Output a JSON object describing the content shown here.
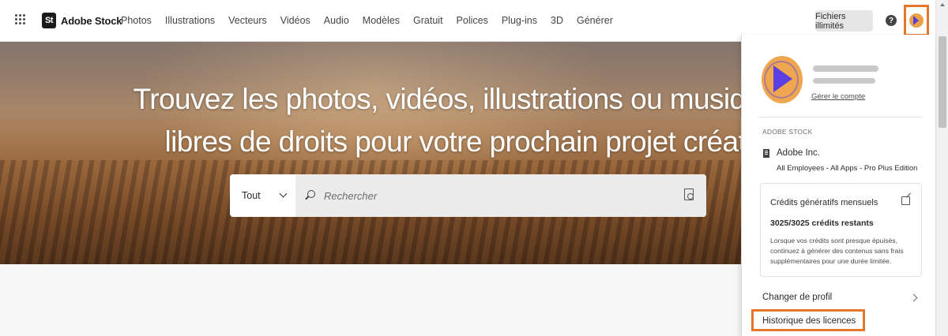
{
  "header": {
    "brand_logo": "St",
    "brand_name": "Adobe Stock",
    "nav_items": [
      "Photos",
      "Illustrations",
      "Vecteurs",
      "Vidéos",
      "Audio",
      "Modèles",
      "Gratuit",
      "Polices",
      "Plug-ins",
      "3D",
      "Générer"
    ],
    "unlimited_button": "Fichiers illimités",
    "help_icon": "?",
    "accent_color": "#e5762a"
  },
  "hero": {
    "title_line1": "Trouvez les photos, vidéos, illustrations ou musiques",
    "title_line2": "libres de droits pour votre prochain projet créatif",
    "search": {
      "type_value": "Tout",
      "placeholder": "Rechercher"
    }
  },
  "profile_panel": {
    "manage_account": "Gérer le compte",
    "section_label": "ADOBE STOCK",
    "org_name": "Adobe Inc.",
    "org_plan": "All Employees - All Apps - Pro Plus Edition",
    "credits_card": {
      "title": "Crédits génératifs mensuels",
      "credits": "3025/3025 crédits restants",
      "description": "Lorsque vos crédits sont presque épuisés, continuez à générer des contenus sans frais supplémentaires pour une durée limitée."
    },
    "menu": {
      "change_profile": "Changer de profil",
      "license_history": "Historique des licences"
    }
  }
}
